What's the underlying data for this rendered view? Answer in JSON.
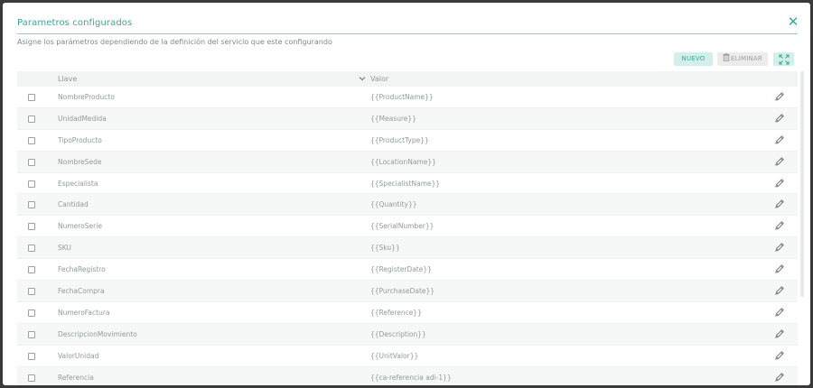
{
  "dialog": {
    "title": "Parametros configurados",
    "subtitle": "Asigne los parámetros dependiendo de la definición del servicio que este configurando",
    "close_icon": "close-icon"
  },
  "toolbar": {
    "new_label": "NUEVO",
    "delete_label": "ELIMINAR",
    "delete_icon": "trash-icon",
    "expand_icon": "expand-icon"
  },
  "table": {
    "columns": {
      "key": "Llave",
      "value": "Valor"
    },
    "rows": [
      {
        "key": "NombreProducto",
        "value": "{{ProductName}}"
      },
      {
        "key": "UnidadMedida",
        "value": "{{Measure}}"
      },
      {
        "key": "TipoProducto",
        "value": "{{ProductType}}"
      },
      {
        "key": "NombreSede",
        "value": "{{LocationName}}"
      },
      {
        "key": "Especialista",
        "value": "{{SpecialistName}}"
      },
      {
        "key": "Cantidad",
        "value": "{{Quantity}}"
      },
      {
        "key": "NumeroSerie",
        "value": "{{SerialNumber}}"
      },
      {
        "key": "SKU",
        "value": "{{Sku}}"
      },
      {
        "key": "FechaRegistro",
        "value": "{{RegisterDate}}"
      },
      {
        "key": "FechaCompra",
        "value": "{{PurchaseDate}}"
      },
      {
        "key": "NumeroFactura",
        "value": "{{Reference}}"
      },
      {
        "key": "DescripcionMovimiento",
        "value": "{{Description}}"
      },
      {
        "key": "ValorUnidad",
        "value": "{{UnitValor}}"
      },
      {
        "key": "Referencia",
        "value": "{{ca-referencia adi-1}}"
      }
    ]
  },
  "colors": {
    "accent": "#3aa796",
    "accent_light": "#d3efeb",
    "text_muted": "#8e999c"
  }
}
